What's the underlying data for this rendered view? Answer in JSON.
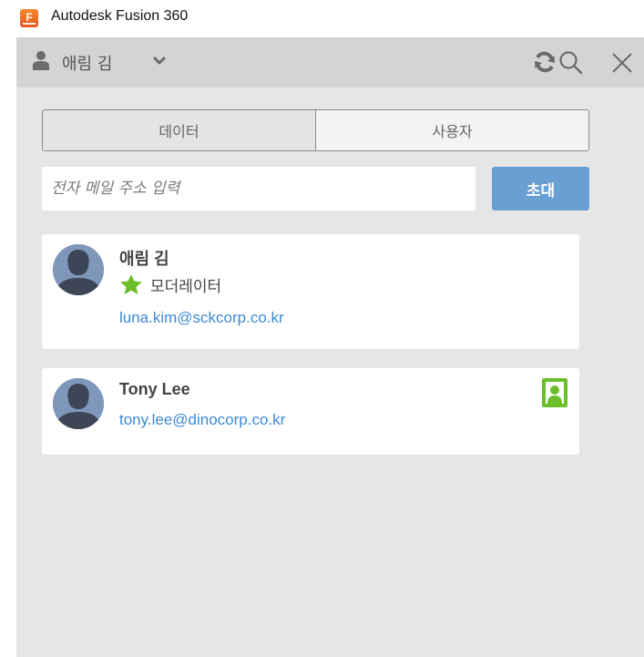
{
  "window": {
    "title": "Autodesk Fusion 360"
  },
  "header": {
    "user_name": "애림 김"
  },
  "tabs": [
    {
      "label": "데이터",
      "active": false
    },
    {
      "label": "사용자",
      "active": true
    }
  ],
  "invite_form": {
    "placeholder": "전자 메일 주소 입력",
    "value": "",
    "button_label": "초대"
  },
  "members": [
    {
      "name": "애림 김",
      "role": "모더레이터",
      "email": "luna.kim@sckcorp.co.kr"
    },
    {
      "name": "Tony Lee",
      "email": "tony.lee@dinocorp.co.kr"
    }
  ],
  "colors": {
    "accent": "#6a9fd4",
    "link": "#3d8ad6",
    "moderator_star": "#6abf2a",
    "badge": "#6abf2a",
    "toolbar": "#d4d4d4",
    "panel": "#e6e6e6"
  },
  "icons": [
    "user-icon",
    "chevron-down-icon",
    "refresh-icon",
    "search-icon",
    "close-icon",
    "avatar-icon",
    "star-icon",
    "user-badge-icon"
  ]
}
